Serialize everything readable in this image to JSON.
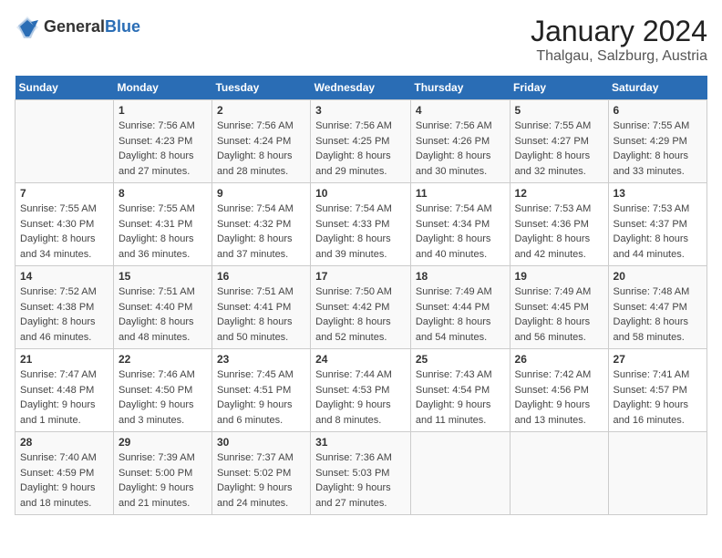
{
  "header": {
    "logo_general": "General",
    "logo_blue": "Blue",
    "title": "January 2024",
    "subtitle": "Thalgau, Salzburg, Austria"
  },
  "weekdays": [
    "Sunday",
    "Monday",
    "Tuesday",
    "Wednesday",
    "Thursday",
    "Friday",
    "Saturday"
  ],
  "weeks": [
    [
      {
        "day": "",
        "info": ""
      },
      {
        "day": "1",
        "info": "Sunrise: 7:56 AM\nSunset: 4:23 PM\nDaylight: 8 hours\nand 27 minutes."
      },
      {
        "day": "2",
        "info": "Sunrise: 7:56 AM\nSunset: 4:24 PM\nDaylight: 8 hours\nand 28 minutes."
      },
      {
        "day": "3",
        "info": "Sunrise: 7:56 AM\nSunset: 4:25 PM\nDaylight: 8 hours\nand 29 minutes."
      },
      {
        "day": "4",
        "info": "Sunrise: 7:56 AM\nSunset: 4:26 PM\nDaylight: 8 hours\nand 30 minutes."
      },
      {
        "day": "5",
        "info": "Sunrise: 7:55 AM\nSunset: 4:27 PM\nDaylight: 8 hours\nand 32 minutes."
      },
      {
        "day": "6",
        "info": "Sunrise: 7:55 AM\nSunset: 4:29 PM\nDaylight: 8 hours\nand 33 minutes."
      }
    ],
    [
      {
        "day": "7",
        "info": "Sunrise: 7:55 AM\nSunset: 4:30 PM\nDaylight: 8 hours\nand 34 minutes."
      },
      {
        "day": "8",
        "info": "Sunrise: 7:55 AM\nSunset: 4:31 PM\nDaylight: 8 hours\nand 36 minutes."
      },
      {
        "day": "9",
        "info": "Sunrise: 7:54 AM\nSunset: 4:32 PM\nDaylight: 8 hours\nand 37 minutes."
      },
      {
        "day": "10",
        "info": "Sunrise: 7:54 AM\nSunset: 4:33 PM\nDaylight: 8 hours\nand 39 minutes."
      },
      {
        "day": "11",
        "info": "Sunrise: 7:54 AM\nSunset: 4:34 PM\nDaylight: 8 hours\nand 40 minutes."
      },
      {
        "day": "12",
        "info": "Sunrise: 7:53 AM\nSunset: 4:36 PM\nDaylight: 8 hours\nand 42 minutes."
      },
      {
        "day": "13",
        "info": "Sunrise: 7:53 AM\nSunset: 4:37 PM\nDaylight: 8 hours\nand 44 minutes."
      }
    ],
    [
      {
        "day": "14",
        "info": "Sunrise: 7:52 AM\nSunset: 4:38 PM\nDaylight: 8 hours\nand 46 minutes."
      },
      {
        "day": "15",
        "info": "Sunrise: 7:51 AM\nSunset: 4:40 PM\nDaylight: 8 hours\nand 48 minutes."
      },
      {
        "day": "16",
        "info": "Sunrise: 7:51 AM\nSunset: 4:41 PM\nDaylight: 8 hours\nand 50 minutes."
      },
      {
        "day": "17",
        "info": "Sunrise: 7:50 AM\nSunset: 4:42 PM\nDaylight: 8 hours\nand 52 minutes."
      },
      {
        "day": "18",
        "info": "Sunrise: 7:49 AM\nSunset: 4:44 PM\nDaylight: 8 hours\nand 54 minutes."
      },
      {
        "day": "19",
        "info": "Sunrise: 7:49 AM\nSunset: 4:45 PM\nDaylight: 8 hours\nand 56 minutes."
      },
      {
        "day": "20",
        "info": "Sunrise: 7:48 AM\nSunset: 4:47 PM\nDaylight: 8 hours\nand 58 minutes."
      }
    ],
    [
      {
        "day": "21",
        "info": "Sunrise: 7:47 AM\nSunset: 4:48 PM\nDaylight: 9 hours\nand 1 minute."
      },
      {
        "day": "22",
        "info": "Sunrise: 7:46 AM\nSunset: 4:50 PM\nDaylight: 9 hours\nand 3 minutes."
      },
      {
        "day": "23",
        "info": "Sunrise: 7:45 AM\nSunset: 4:51 PM\nDaylight: 9 hours\nand 6 minutes."
      },
      {
        "day": "24",
        "info": "Sunrise: 7:44 AM\nSunset: 4:53 PM\nDaylight: 9 hours\nand 8 minutes."
      },
      {
        "day": "25",
        "info": "Sunrise: 7:43 AM\nSunset: 4:54 PM\nDaylight: 9 hours\nand 11 minutes."
      },
      {
        "day": "26",
        "info": "Sunrise: 7:42 AM\nSunset: 4:56 PM\nDaylight: 9 hours\nand 13 minutes."
      },
      {
        "day": "27",
        "info": "Sunrise: 7:41 AM\nSunset: 4:57 PM\nDaylight: 9 hours\nand 16 minutes."
      }
    ],
    [
      {
        "day": "28",
        "info": "Sunrise: 7:40 AM\nSunset: 4:59 PM\nDaylight: 9 hours\nand 18 minutes."
      },
      {
        "day": "29",
        "info": "Sunrise: 7:39 AM\nSunset: 5:00 PM\nDaylight: 9 hours\nand 21 minutes."
      },
      {
        "day": "30",
        "info": "Sunrise: 7:37 AM\nSunset: 5:02 PM\nDaylight: 9 hours\nand 24 minutes."
      },
      {
        "day": "31",
        "info": "Sunrise: 7:36 AM\nSunset: 5:03 PM\nDaylight: 9 hours\nand 27 minutes."
      },
      {
        "day": "",
        "info": ""
      },
      {
        "day": "",
        "info": ""
      },
      {
        "day": "",
        "info": ""
      }
    ]
  ]
}
